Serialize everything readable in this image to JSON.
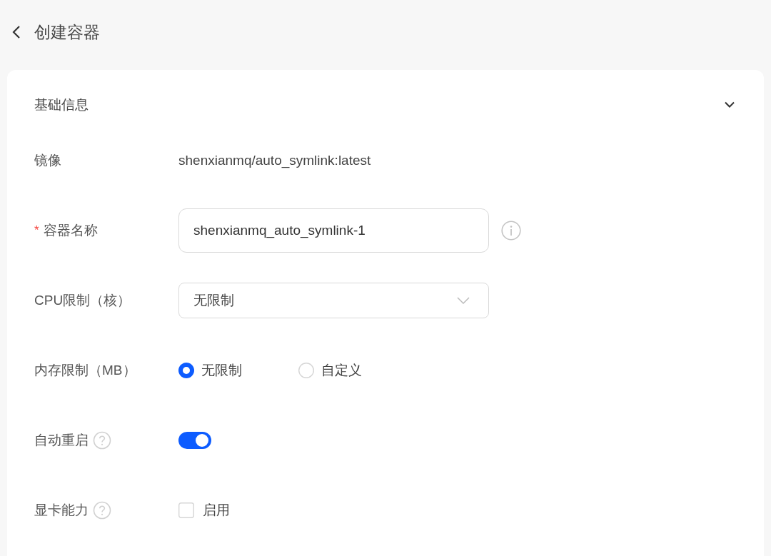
{
  "header": {
    "title": "创建容器"
  },
  "section": {
    "title": "基础信息",
    "expanded": true
  },
  "fields": [
    {
      "kind": "text",
      "label": "镜像",
      "value": "shenxianmq/auto_symlink:latest"
    },
    {
      "kind": "input",
      "label": "容器名称",
      "required_mark": "*",
      "value": "shenxianmq_auto_symlink-1",
      "info": true
    },
    {
      "kind": "select",
      "label": "CPU限制（核）",
      "value": "无限制"
    },
    {
      "kind": "radio",
      "label": "内存限制（MB）",
      "options": [
        {
          "label": "无限制",
          "selected": true
        },
        {
          "label": "自定义",
          "selected": false
        }
      ]
    },
    {
      "kind": "switch",
      "label": "自动重启",
      "help": true,
      "on": true
    },
    {
      "kind": "checkbox",
      "label": "显卡能力",
      "help": true,
      "option": {
        "label": "启用",
        "checked": false
      }
    }
  ]
}
